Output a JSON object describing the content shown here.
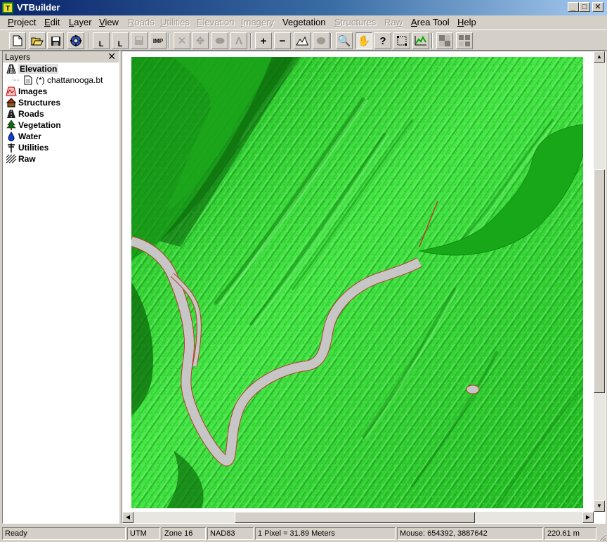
{
  "window": {
    "title": "VTBuilder"
  },
  "menu": {
    "items": [
      {
        "label": "Project",
        "mnemonic": "P",
        "rest": "roject",
        "disabled": false
      },
      {
        "label": "Edit",
        "mnemonic": "E",
        "rest": "dit",
        "disabled": false
      },
      {
        "label": "Layer",
        "mnemonic": "L",
        "rest": "ayer",
        "disabled": false
      },
      {
        "label": "View",
        "mnemonic": "V",
        "rest": "iew",
        "disabled": false
      },
      {
        "label": "Roads",
        "mnemonic": "R",
        "rest": "oads",
        "disabled": true
      },
      {
        "label": "Utilities",
        "mnemonic": "U",
        "rest": "tilities",
        "disabled": true
      },
      {
        "label": "Elevation",
        "mnemonic": "E",
        "rest": "levation",
        "disabled": true
      },
      {
        "label": "Imagery",
        "mnemonic": "I",
        "rest": "magery",
        "disabled": true
      },
      {
        "label": "Vegetation",
        "mnemonic": "g",
        "rest": "",
        "disabled": false
      },
      {
        "label": "Structures",
        "mnemonic": "S",
        "rest": "tructures",
        "disabled": true
      },
      {
        "label": "Raw",
        "mnemonic": "w",
        "rest": "",
        "disabled": true
      },
      {
        "label": "Area Tool",
        "mnemonic": "A",
        "rest": "rea Tool",
        "disabled": false
      },
      {
        "label": "Help",
        "mnemonic": "H",
        "rest": "elp",
        "disabled": false
      }
    ]
  },
  "toolbar": {
    "buttons": [
      {
        "icon": "new-document-icon"
      },
      {
        "icon": "open-folder-icon"
      },
      {
        "icon": "save-icon"
      },
      {
        "icon": "preferences-icon"
      },
      {
        "icon": "new-layer-icon",
        "glyph": "L"
      },
      {
        "icon": "open-layer-icon",
        "glyph": "L"
      },
      {
        "icon": "save-layer-icon",
        "disabled": true
      },
      {
        "icon": "import-icon",
        "glyph": "IMP"
      },
      {
        "icon": "delete-icon",
        "glyph": "✕",
        "disabled": true
      },
      {
        "icon": "move-icon",
        "glyph": "✥",
        "disabled": true
      },
      {
        "icon": "ellipse-icon",
        "glyph": "⬬",
        "disabled": true
      },
      {
        "icon": "peak-icon",
        "glyph": "Λ",
        "disabled": true
      },
      {
        "icon": "zoom-in-icon",
        "glyph": "+"
      },
      {
        "icon": "zoom-out-icon",
        "glyph": "−"
      },
      {
        "icon": "elevation-import-icon"
      },
      {
        "icon": "fill-icon",
        "disabled": true
      },
      {
        "icon": "magnifier-icon",
        "glyph": "🔍"
      },
      {
        "icon": "pan-hand-icon",
        "glyph": "✋",
        "pressed": true
      },
      {
        "icon": "distance-tool-icon",
        "glyph": "?"
      },
      {
        "icon": "area-select-icon"
      },
      {
        "icon": "profile-icon"
      },
      {
        "icon": "merge-layers-icon"
      },
      {
        "icon": "sample-layers-icon"
      }
    ]
  },
  "layers_panel": {
    "title": "Layers",
    "close_glyph": "✕",
    "items": [
      {
        "label": "Elevation",
        "icon": "elevation-grid-icon",
        "selected": true
      },
      {
        "label": "Images",
        "icon": "images-icon"
      },
      {
        "label": "Structures",
        "icon": "house-icon"
      },
      {
        "label": "Roads",
        "icon": "road-icon"
      },
      {
        "label": "Vegetation",
        "icon": "tree-icon"
      },
      {
        "label": "Water",
        "icon": "water-drop-icon"
      },
      {
        "label": "Utilities",
        "icon": "power-pole-icon"
      },
      {
        "label": "Raw",
        "icon": "raw-hatch-icon"
      }
    ],
    "elevation_child": {
      "label": "(*) chattanooga.bt",
      "icon": "document-icon"
    }
  },
  "colors": {
    "terrain_light": "#45e745",
    "terrain_mid": "#1fb51f",
    "terrain_dark": "#0c6f0c",
    "lake": "#18a718",
    "river": "#c6c6c6",
    "river_outline": "#c0392b"
  },
  "statusbar": {
    "ready": "Ready",
    "projection": "UTM",
    "zone": "Zone 16",
    "datum": "NAD83",
    "pixel_size": "1 Pixel = 31.89 Meters",
    "mouse": "Mouse: 654392, 3887642",
    "elevation": "220.61 m"
  }
}
